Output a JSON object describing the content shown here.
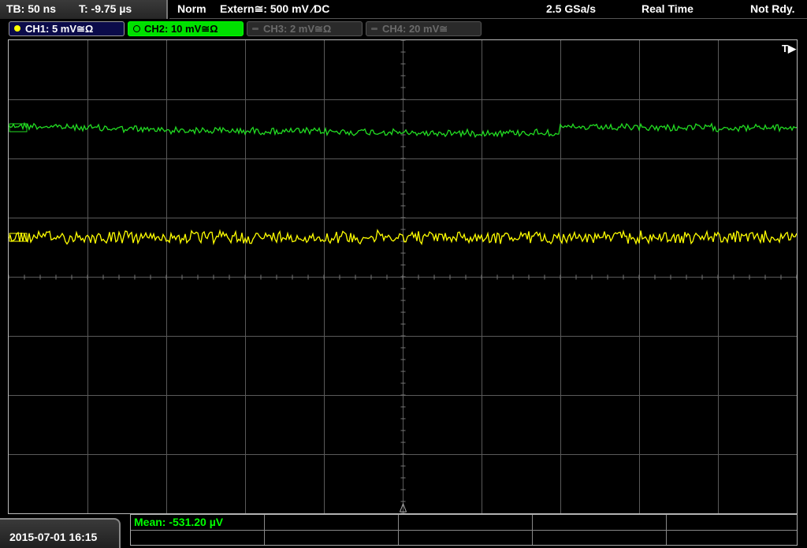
{
  "timebase": {
    "tb_label": "TB: 50 ns",
    "trigger_time": "T: -9.75 µs"
  },
  "status": {
    "mode": "Norm",
    "trigger_source": "Extern≅: 500 mV ⁄DC",
    "sample_rate": "2.5 GSa/s",
    "acq_mode": "Real Time",
    "state": "Not Rdy."
  },
  "channels": [
    {
      "label": "CH1: 5 mV≅Ω",
      "color": "#ffff00",
      "active": true
    },
    {
      "label": "CH2: 10 mV≅Ω",
      "color": "#00e000",
      "active": true
    },
    {
      "label": "CH3: 2 mV≅Ω",
      "color": "#555555",
      "active": false
    },
    {
      "label": "CH4: 20 mV≅",
      "color": "#555555",
      "active": false
    }
  ],
  "trigger_marker": "T▶",
  "date": "2015-07-01 16:15",
  "measurement": {
    "mean": "Mean: -531.20 µV"
  },
  "colors": {
    "ch1_trace": "#ffff00",
    "ch2_trace": "#22dd22",
    "grid": "#5a5a5a"
  }
}
